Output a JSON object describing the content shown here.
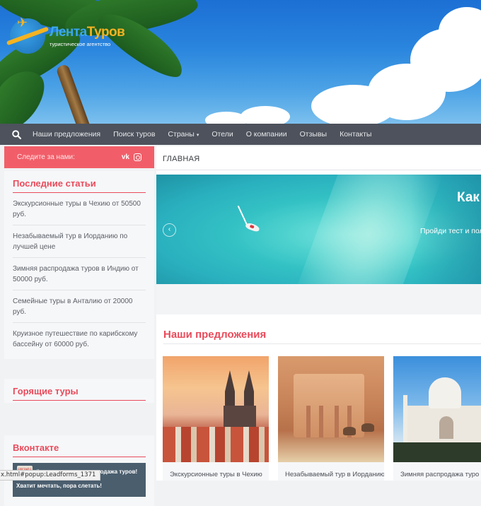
{
  "header": {
    "logo_name_part1": "Лента",
    "logo_name_part2": "Туров",
    "logo_tagline": "туристическое агентство"
  },
  "nav": {
    "search_icon": "search-icon",
    "items": [
      {
        "label": "Наши предложения"
      },
      {
        "label": "Поиск туров"
      },
      {
        "label": "Страны",
        "has_dropdown": true
      },
      {
        "label": "Отели"
      },
      {
        "label": "О компании"
      },
      {
        "label": "Отзывы"
      },
      {
        "label": "Контакты"
      }
    ]
  },
  "sidebar": {
    "follow_label": "Следите за нами:",
    "social_vk": "vk",
    "social_instagram": "instagram-icon",
    "recent_title": "Последние статьи",
    "articles": [
      "Экскурсионные туры в Чехию от 50500 руб.",
      "Незабываемый тур в Иорданию по лучшей цене",
      "Зимняя распродажа туров в Индию от 50000 руб.",
      "Семейные туры в Анталию от 20000 руб.",
      "Круизное путешествие по карибскому бассейну от 60000 руб."
    ],
    "hot_title": "Горящие туры",
    "vk_title": "Вконтакте",
    "vk_post_badge": "СЛЕТАЙ С НАМИ",
    "vk_post_hashtag": "#слетатьснами - распродажа туров!",
    "vk_post_text": "Хватит мечтать, пора слетать!"
  },
  "main": {
    "breadcrumb": "ГЛАВНАЯ",
    "slide_headline": "Как",
    "slide_subtitle": "Пройди тест и пол",
    "offers_title": "Наши предложения",
    "cards": [
      {
        "caption": "Экскурсионные туры в Чехию"
      },
      {
        "caption": "Незабываемый тур в Иорданию"
      },
      {
        "caption": "Зимняя распродажа туро"
      }
    ]
  },
  "status_bar": "x.html#popup:Leadforms_1371",
  "colors": {
    "accent": "#e94b5b",
    "nav_bg": "#4d525c",
    "follow_bg": "#f15e69"
  }
}
